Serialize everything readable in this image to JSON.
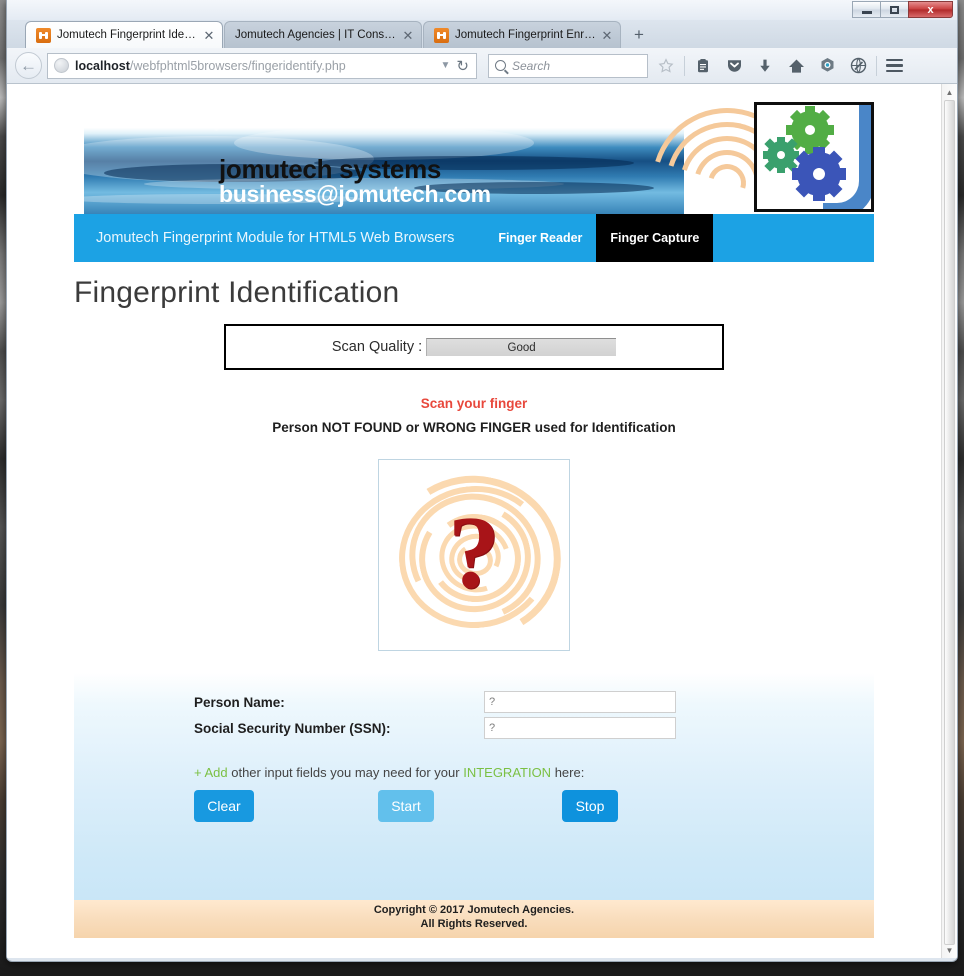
{
  "window": {
    "minimize_label": "Minimize",
    "maximize_label": "Maximize",
    "close_label": "x"
  },
  "browser": {
    "tabs": [
      {
        "title": "Jomutech Fingerprint Ident...",
        "close": "✕",
        "active": true
      },
      {
        "title": "Jomutech Agencies | IT Consul...",
        "close": "✕",
        "active": false
      },
      {
        "title": "Jomutech Fingerprint Enrol...",
        "close": "✕",
        "active": false
      }
    ],
    "new_tab_label": "+",
    "back_label": "←",
    "url_host": "localhost",
    "url_path": "/webfphtml5browsers/fingeridentify.php",
    "url_dropdown": "▼",
    "reload_label": "↻",
    "search_placeholder": "Search",
    "toolbar_icons": [
      "bookmark-star-icon",
      "reader-list-icon",
      "pocket-shield-icon",
      "downloads-arrow-icon",
      "home-icon",
      "sync-hexagon-icon",
      "globe-pencil-icon"
    ],
    "menu_label": "Open menu"
  },
  "site": {
    "logo_line1": "jomutech systems",
    "logo_line2": "business@jomutech.com",
    "nav": {
      "brand": "Jomutech Fingerprint Module for HTML5 Web Browsers",
      "items": [
        {
          "label": "Finger Reader",
          "active": false
        },
        {
          "label": "Finger Capture",
          "active": true
        }
      ]
    },
    "page_title": "Fingerprint Identification",
    "quality": {
      "label": "Scan Quality :",
      "value": "Good"
    },
    "scan_message": "Scan your finger",
    "result_message": "Person NOT FOUND or WRONG FINGER used for Identification",
    "fingerprint_image_glyph": "?",
    "form": {
      "fields": [
        {
          "label": "Person Name:",
          "value": "?",
          "placeholder": ""
        },
        {
          "label": "Social Security Number (SSN):",
          "value": "?",
          "placeholder": ""
        }
      ],
      "add_note_prefix": "+ Add",
      "add_note_middle": " other input fields you may need for your ",
      "add_note_highlight": "INTEGRATION",
      "add_note_suffix": " here:"
    },
    "buttons": {
      "clear": "Clear",
      "start": "Start",
      "stop": "Stop"
    },
    "footer_line1": "Copyright © 2017 Jomutech Agencies.",
    "footer_line2": "All Rights Reserved."
  },
  "colors": {
    "nav_blue": "#1ca2e4",
    "active_nav": "#000000",
    "alert_red": "#e8483c",
    "accent_green": "#7bc043",
    "button_primary": "#1899e0",
    "button_disabled": "#62c0ec",
    "footer_peach": "#f6d4ac"
  }
}
